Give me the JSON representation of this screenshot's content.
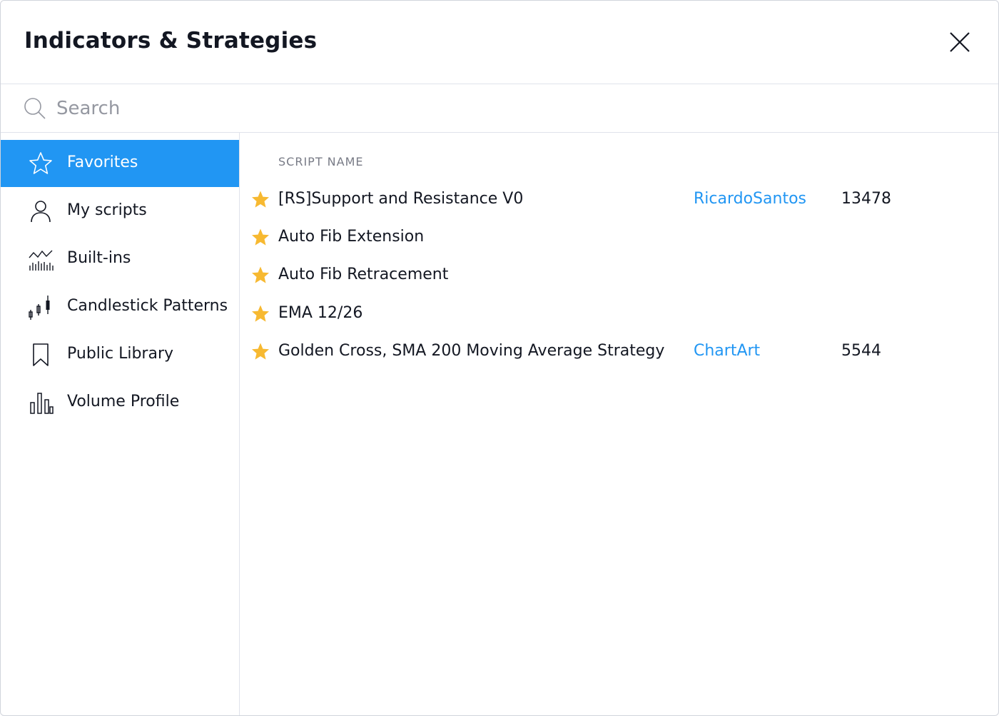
{
  "dialog": {
    "title": "Indicators & Strategies"
  },
  "search": {
    "placeholder": "Search",
    "value": ""
  },
  "sidebar": {
    "items": [
      {
        "label": "Favorites",
        "icon": "star-outline-icon",
        "active": true
      },
      {
        "label": "My scripts",
        "icon": "user-icon",
        "active": false
      },
      {
        "label": "Built-ins",
        "icon": "built-ins-chart-icon",
        "active": false
      },
      {
        "label": "Candlestick Patterns",
        "icon": "candlestick-icon",
        "active": false
      },
      {
        "label": "Public Library",
        "icon": "bookmark-icon",
        "active": false
      },
      {
        "label": "Volume Profile",
        "icon": "volume-profile-icon",
        "active": false
      }
    ]
  },
  "table": {
    "header": "SCRIPT NAME",
    "rows": [
      {
        "name": "[RS]Support and Resistance V0",
        "author": "RicardoSantos",
        "likes": "13478"
      },
      {
        "name": "Auto Fib Extension",
        "author": "",
        "likes": ""
      },
      {
        "name": "Auto Fib Retracement",
        "author": "",
        "likes": ""
      },
      {
        "name": "EMA 12/26",
        "author": "",
        "likes": ""
      },
      {
        "name": "Golden Cross, SMA 200 Moving Average Strategy (…",
        "author": "ChartArt",
        "likes": "5544"
      }
    ]
  },
  "colors": {
    "accent": "#2196f3",
    "star": "#f7b931",
    "text": "#131722",
    "muted": "#787b86",
    "border": "#e0e3eb"
  }
}
